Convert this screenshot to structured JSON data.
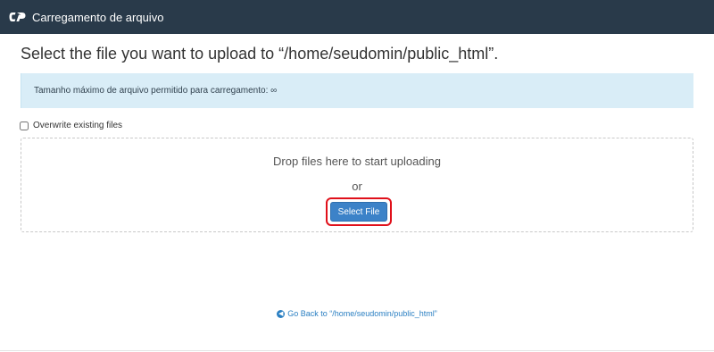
{
  "header": {
    "logo_icon": "cpanel-logo-icon",
    "title": "Carregamento de arquivo",
    "background": "#293a4a"
  },
  "main": {
    "heading": "Select the file you want to upload to “/home/seudomin/public_html”.",
    "info": {
      "text": "Tamanho máximo de arquivo permitido para carregamento: ∞",
      "background": "#d9edf7"
    },
    "overwrite": {
      "label": "Overwrite existing files",
      "checked": false
    },
    "dropzone": {
      "drop_text": "Drop files here to start uploading",
      "or_text": "or",
      "select_button": "Select File",
      "button_color": "#3c82c8",
      "highlight_color": "#e0101a"
    },
    "go_back": {
      "icon": "arrow-left-circle-icon",
      "label": "Go Back to “/home/seudomin/public_html”",
      "color": "#2a7fc2"
    }
  }
}
